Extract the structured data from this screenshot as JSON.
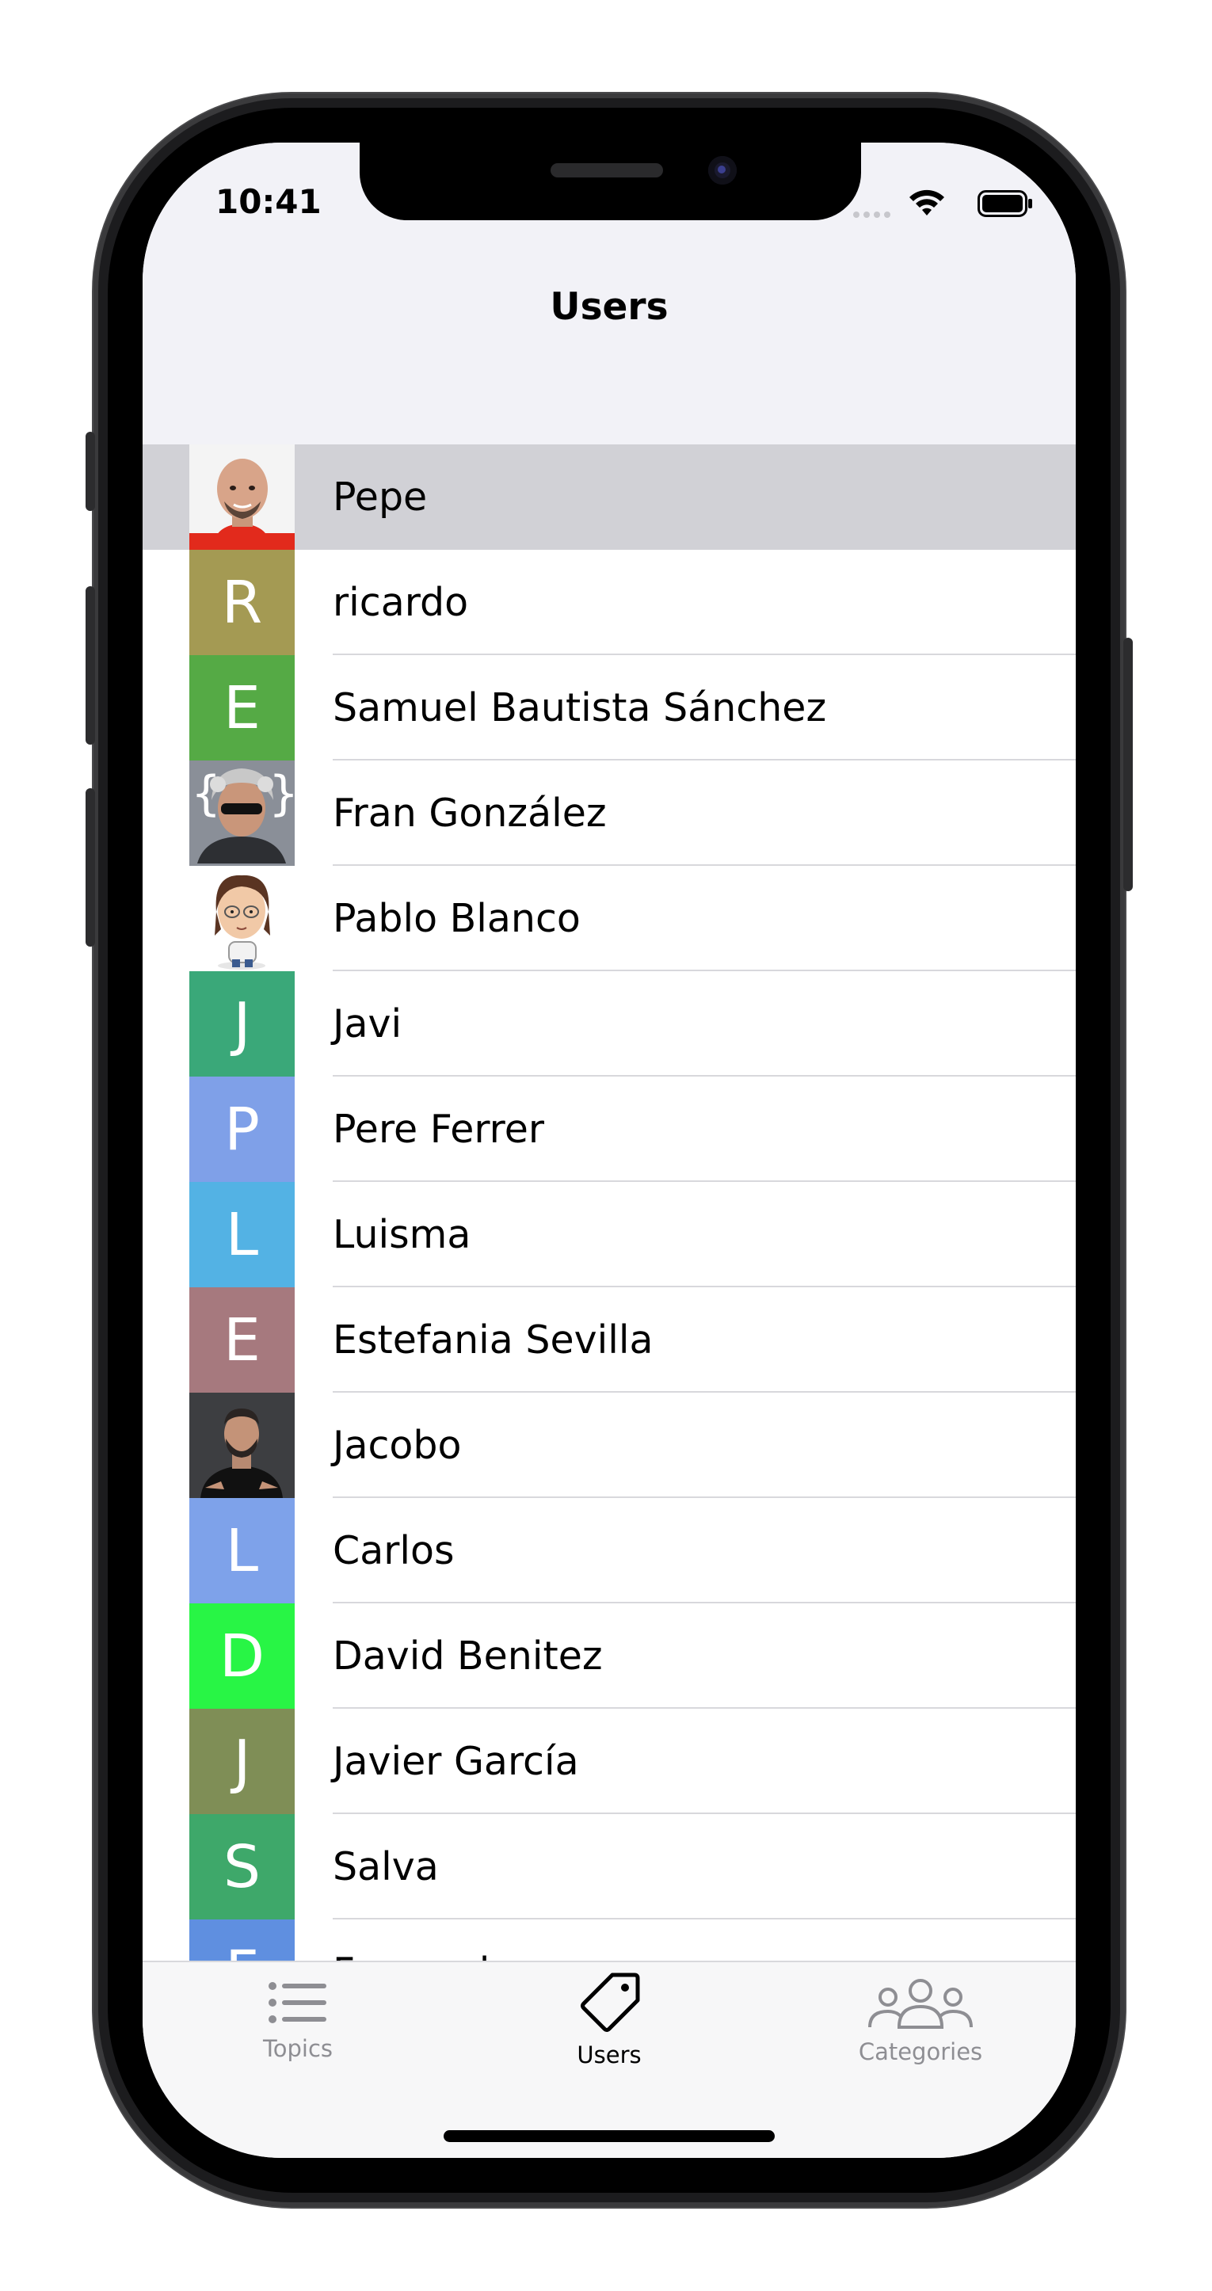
{
  "status_bar": {
    "time": "10:41"
  },
  "nav": {
    "title": "Users"
  },
  "users": [
    {
      "name": "Pepe",
      "avatar": "photo-man-bald",
      "selected": true
    },
    {
      "name": "ricardo",
      "avatar": "letter",
      "letter": "R",
      "color": "#a49a53"
    },
    {
      "name": "Samuel Bautista Sánchez",
      "avatar": "letter",
      "letter": "E",
      "color": "#55aa45"
    },
    {
      "name": "Fran González",
      "avatar": "photo-curly-hair"
    },
    {
      "name": "Pablo Blanco",
      "avatar": "cartoon-avatar"
    },
    {
      "name": "Javi",
      "avatar": "letter",
      "letter": "J",
      "color": "#3aa879"
    },
    {
      "name": "Pere Ferrer",
      "avatar": "letter",
      "letter": "P",
      "color": "#7fa0e8"
    },
    {
      "name": "Luisma",
      "avatar": "letter",
      "letter": "L",
      "color": "#53b2e4"
    },
    {
      "name": "Estefania Sevilla",
      "avatar": "letter",
      "letter": "E",
      "color": "#a6797e"
    },
    {
      "name": "Jacobo",
      "avatar": "photo-man-dark"
    },
    {
      "name": "Carlos",
      "avatar": "letter",
      "letter": "L",
      "color": "#7ea2ea"
    },
    {
      "name": "David Benitez",
      "avatar": "letter",
      "letter": "D",
      "color": "#28f545"
    },
    {
      "name": "Javier García",
      "avatar": "letter",
      "letter": "J",
      "color": "#7f8e56"
    },
    {
      "name": "Salva",
      "avatar": "letter",
      "letter": "S",
      "color": "#3ea86a"
    },
    {
      "name": "Fernando",
      "avatar": "letter",
      "letter": "F",
      "color": "#5f8fe0"
    }
  ],
  "tabbar": {
    "tabs": [
      {
        "label": "Topics",
        "icon": "list-icon",
        "active": false
      },
      {
        "label": "Users",
        "icon": "tag-icon",
        "active": true
      },
      {
        "label": "Categories",
        "icon": "people-icon",
        "active": false
      }
    ]
  }
}
